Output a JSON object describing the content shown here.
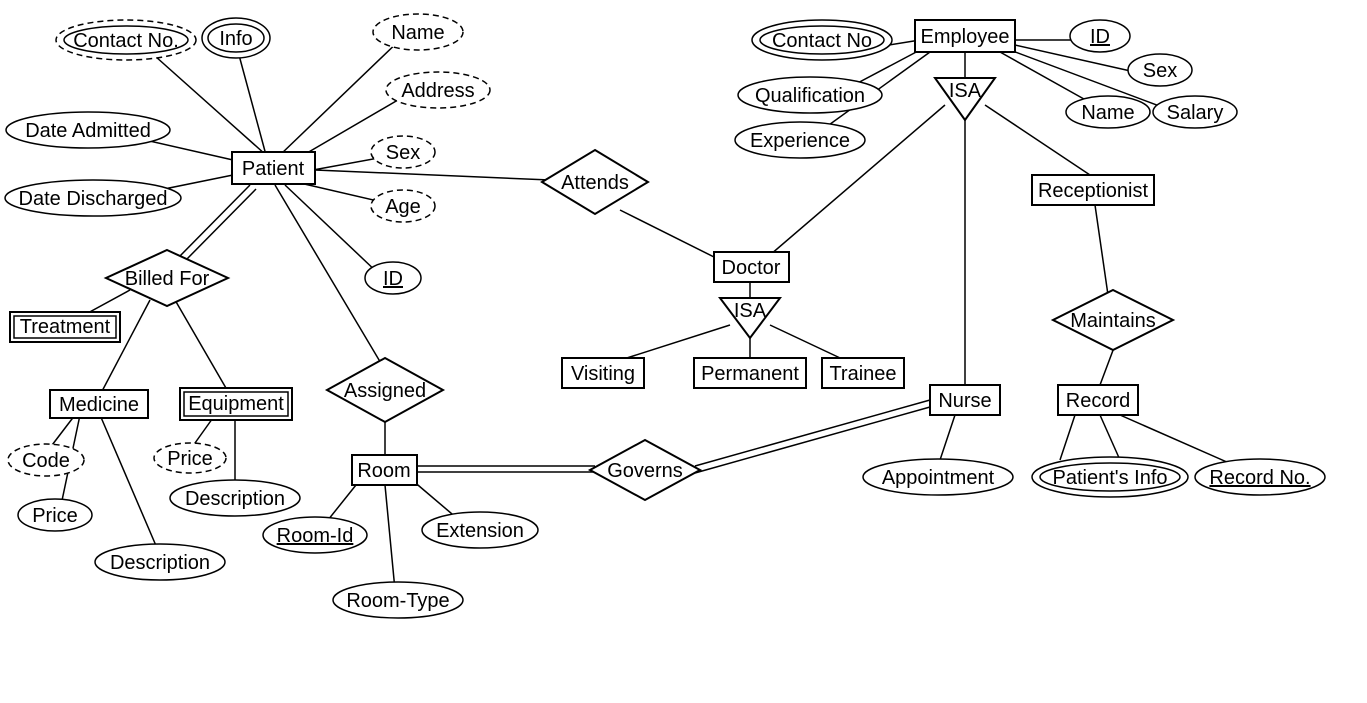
{
  "entities": {
    "patient": "Patient",
    "employee": "Employee",
    "doctor": "Doctor",
    "visiting": "Visiting",
    "permanent": "Permanent",
    "trainee": "Trainee",
    "nurse": "Nurse",
    "receptionist": "Receptionist",
    "record": "Record",
    "medicine": "Medicine",
    "room": "Room",
    "treatment": "Treatment",
    "equipment": "Equipment"
  },
  "relationships": {
    "attends": "Attends",
    "billed_for": "Billed For",
    "assigned": "Assigned",
    "governs": "Governs",
    "maintains": "Maintains",
    "isa_employee": "ISA",
    "isa_doctor": "ISA"
  },
  "attributes": {
    "patient": {
      "contact_no": "Contact No.",
      "info": "Info",
      "name": "Name",
      "address": "Address",
      "sex": "Sex",
      "age": "Age",
      "id": "ID",
      "date_admitted": "Date Admitted",
      "date_discharged": "Date Discharged"
    },
    "employee": {
      "contact_no": "Contact No",
      "qualification": "Qualification",
      "experience": "Experience",
      "id": "ID",
      "sex": "Sex",
      "name": "Name",
      "salary": "Salary"
    },
    "medicine": {
      "code": "Code",
      "price": "Price",
      "description": "Description"
    },
    "equipment": {
      "price": "Price",
      "description": "Description"
    },
    "room": {
      "room_id": "Room-Id",
      "room_type": "Room-Type",
      "extension": "Extension"
    },
    "nurse": {
      "appointment": "Appointment"
    },
    "record": {
      "patients_info": "Patient's Info",
      "record_no": "Record No."
    }
  }
}
